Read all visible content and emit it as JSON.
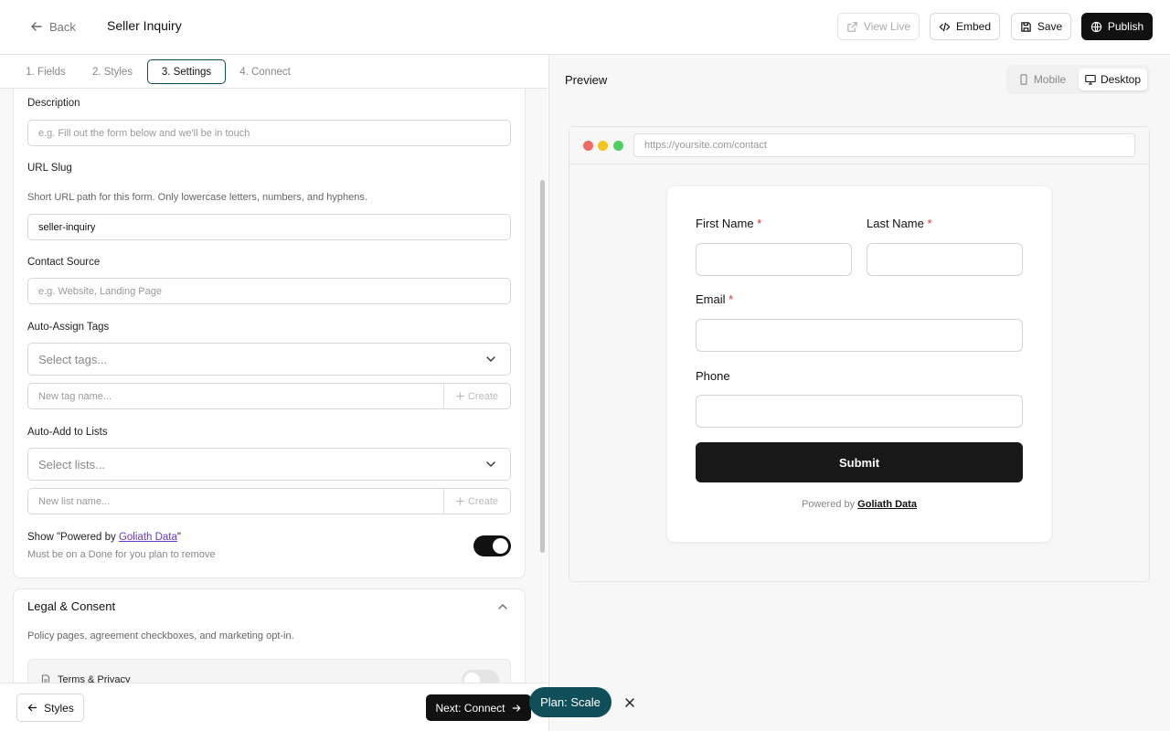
{
  "header": {
    "back_label": "Back",
    "title": "Seller Inquiry",
    "view_live_label": "View Live",
    "embed_label": "Embed",
    "save_label": "Save",
    "publish_label": "Publish"
  },
  "tabs": [
    {
      "label": "1. Fields",
      "active": false
    },
    {
      "label": "2. Styles",
      "active": false
    },
    {
      "label": "3. Settings",
      "active": true
    },
    {
      "label": "4. Connect",
      "active": false
    }
  ],
  "settings": {
    "description": {
      "label": "Description",
      "placeholder": "e.g. Fill out the form below and we'll be in touch"
    },
    "url_slug": {
      "label": "URL Slug",
      "hint": "Short URL path for this form. Only lowercase letters, numbers, and hyphens.",
      "value": "seller-inquiry"
    },
    "contact_source": {
      "label": "Contact Source",
      "placeholder": "e.g. Website, Landing Page"
    },
    "auto_assign_tags": {
      "label": "Auto-Assign Tags",
      "select_placeholder": "Select tags...",
      "new_placeholder": "New tag name...",
      "create_label": "Create"
    },
    "auto_add_lists": {
      "label": "Auto-Add to Lists",
      "select_placeholder": "Select lists...",
      "new_placeholder": "New list name...",
      "create_label": "Create"
    },
    "powered_by": {
      "label_prefix": "Show \"Powered by ",
      "link": "Goliath Data",
      "label_suffix": "\"",
      "hint": "Must be on a Done for you plan to remove",
      "enabled": true
    }
  },
  "legal": {
    "title": "Legal & Consent",
    "description": "Policy pages, agreement checkboxes, and marketing opt-in.",
    "terms_label": "Terms & Privacy",
    "terms_enabled": false
  },
  "footer": {
    "styles_label": "Styles",
    "next_label": "Next: Connect",
    "plan_label": "Plan: Scale"
  },
  "preview": {
    "title": "Preview",
    "mobile_label": "Mobile",
    "desktop_label": "Desktop",
    "active_device": "desktop",
    "url": "https://yoursite.com/contact",
    "fields": [
      {
        "label": "First Name",
        "required": true
      },
      {
        "label": "Last Name",
        "required": true
      },
      {
        "label": "Email",
        "required": true
      },
      {
        "label": "Phone",
        "required": false
      }
    ],
    "required_mark": "*",
    "submit_label": "Submit",
    "powered_prefix": "Powered by",
    "powered_brand": "Goliath Data"
  },
  "colors": {
    "accent": "#0f4f5a",
    "primary_dark": "#111111",
    "link": "#6b39c6",
    "required": "#d92d2d"
  }
}
